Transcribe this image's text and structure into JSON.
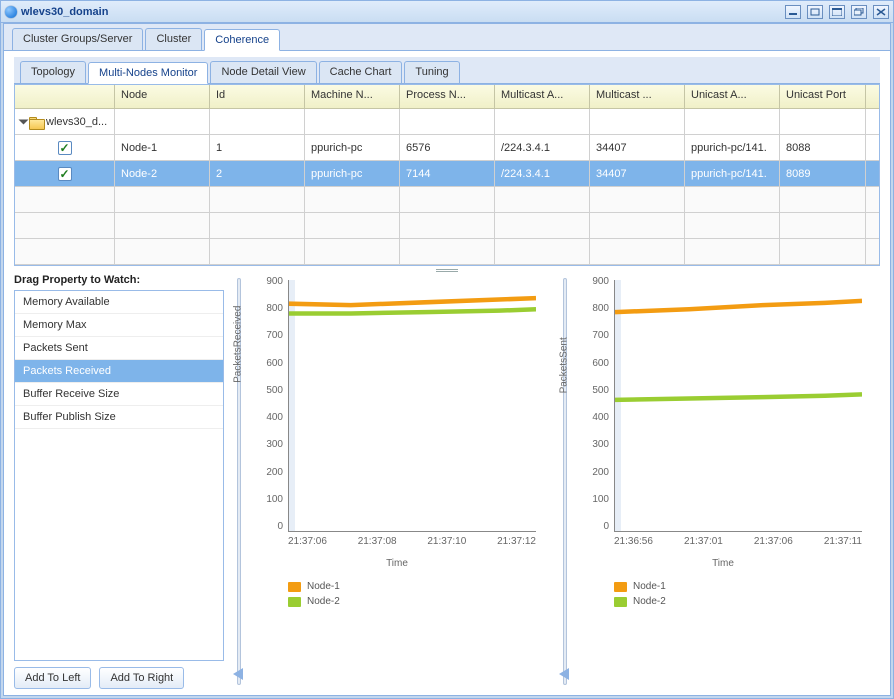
{
  "window": {
    "title": "wlevs30_domain"
  },
  "tabs_outer": {
    "items": [
      {
        "label": "Cluster Groups/Server",
        "active": false
      },
      {
        "label": "Cluster",
        "active": false
      },
      {
        "label": "Coherence",
        "active": true
      }
    ]
  },
  "tabs_inner": {
    "items": [
      {
        "label": "Topology",
        "active": false
      },
      {
        "label": "Multi-Nodes Monitor",
        "active": true
      },
      {
        "label": "Node Detail View",
        "active": false
      },
      {
        "label": "Cache Chart",
        "active": false
      },
      {
        "label": "Tuning",
        "active": false
      }
    ]
  },
  "grid": {
    "columns": {
      "tree": "",
      "node": "Node",
      "id": "Id",
      "machine": "Machine N...",
      "process": "Process N...",
      "multicast_addr": "Multicast A...",
      "multicast_port": "Multicast ...",
      "unicast_addr": "Unicast A...",
      "unicast_port": "Unicast Port"
    },
    "domain_row": {
      "label": "wlevs30_d..."
    },
    "rows": [
      {
        "checked": true,
        "selected": false,
        "node": "Node-1",
        "id": "1",
        "machine": "ppurich-pc",
        "process": "6576",
        "multicast_addr": "/224.3.4.1",
        "multicast_port": "34407",
        "unicast_addr": "ppurich-pc/141.",
        "unicast_port": "8088"
      },
      {
        "checked": true,
        "selected": true,
        "node": "Node-2",
        "id": "2",
        "machine": "ppurich-pc",
        "process": "7144",
        "multicast_addr": "/224.3.4.1",
        "multicast_port": "34407",
        "unicast_addr": "ppurich-pc/141.",
        "unicast_port": "8089"
      }
    ]
  },
  "drag_panel": {
    "title": "Drag Property to Watch:",
    "items": [
      {
        "label": "Memory Available",
        "selected": false
      },
      {
        "label": "Memory Max",
        "selected": false
      },
      {
        "label": "Packets Sent",
        "selected": false
      },
      {
        "label": "Packets Received",
        "selected": true
      },
      {
        "label": "Buffer Receive Size",
        "selected": false
      },
      {
        "label": "Buffer Publish Size",
        "selected": false
      }
    ],
    "buttons": {
      "add_left": "Add To Left",
      "add_right": "Add To Right"
    }
  },
  "chart_data": [
    {
      "type": "line",
      "title": "",
      "ylabel": "PacketsReceived",
      "xlabel": "Time",
      "ylim": [
        0,
        900
      ],
      "y_ticks": [
        0,
        100,
        200,
        300,
        400,
        500,
        600,
        700,
        800,
        900
      ],
      "x_ticks": [
        "21:37:06",
        "21:37:08",
        "21:37:10",
        "21:37:12"
      ],
      "series": [
        {
          "name": "Node-1",
          "color": "#f39c12",
          "values": [
            [
              0,
              815
            ],
            [
              25,
              810
            ],
            [
              55,
              820
            ],
            [
              85,
              830
            ],
            [
              100,
              835
            ]
          ]
        },
        {
          "name": "Node-2",
          "color": "#9acd32",
          "values": [
            [
              0,
              780
            ],
            [
              25,
              780
            ],
            [
              55,
              785
            ],
            [
              85,
              790
            ],
            [
              100,
              795
            ]
          ]
        }
      ]
    },
    {
      "type": "line",
      "title": "",
      "ylabel": "PacketsSent",
      "xlabel": "Time",
      "ylim": [
        0,
        900
      ],
      "y_ticks": [
        0,
        100,
        200,
        300,
        400,
        500,
        600,
        700,
        800,
        900
      ],
      "x_ticks": [
        "21:36:56",
        "21:37:01",
        "21:37:06",
        "21:37:11"
      ],
      "series": [
        {
          "name": "Node-1",
          "color": "#f39c12",
          "values": [
            [
              0,
              785
            ],
            [
              30,
              795
            ],
            [
              60,
              810
            ],
            [
              85,
              818
            ],
            [
              100,
              825
            ]
          ]
        },
        {
          "name": "Node-2",
          "color": "#9acd32",
          "values": [
            [
              0,
              470
            ],
            [
              30,
              475
            ],
            [
              60,
              480
            ],
            [
              85,
              485
            ],
            [
              100,
              490
            ]
          ]
        }
      ]
    }
  ]
}
